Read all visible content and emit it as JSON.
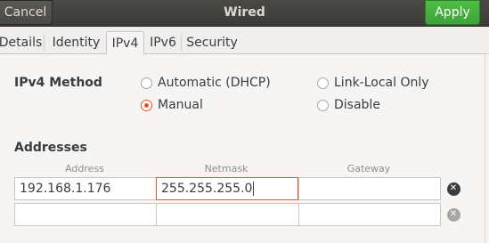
{
  "header": {
    "cancel_label": "Cancel",
    "title": "Wired",
    "apply_label": "Apply"
  },
  "tabs": [
    {
      "label": "Details"
    },
    {
      "label": "Identity"
    },
    {
      "label": "IPv4"
    },
    {
      "label": "IPv6"
    },
    {
      "label": "Security"
    }
  ],
  "active_tab": "IPv4",
  "ipv4": {
    "method_label": "IPv4 Method",
    "methods": [
      {
        "label": "Automatic (DHCP)",
        "selected": false
      },
      {
        "label": "Link-Local Only",
        "selected": false
      },
      {
        "label": "Manual",
        "selected": true
      },
      {
        "label": "Disable",
        "selected": false
      }
    ]
  },
  "addresses": {
    "section_label": "Addresses",
    "columns": [
      "Address",
      "Netmask",
      "Gateway"
    ],
    "rows": [
      {
        "address": "192.168.1.176",
        "netmask": "255.255.255.0",
        "gateway": ""
      },
      {
        "address": "",
        "netmask": "",
        "gateway": ""
      }
    ]
  },
  "colors": {
    "accent": "#e95420",
    "apply_green": "#3ea238",
    "header_bg": "#3c3b37"
  }
}
